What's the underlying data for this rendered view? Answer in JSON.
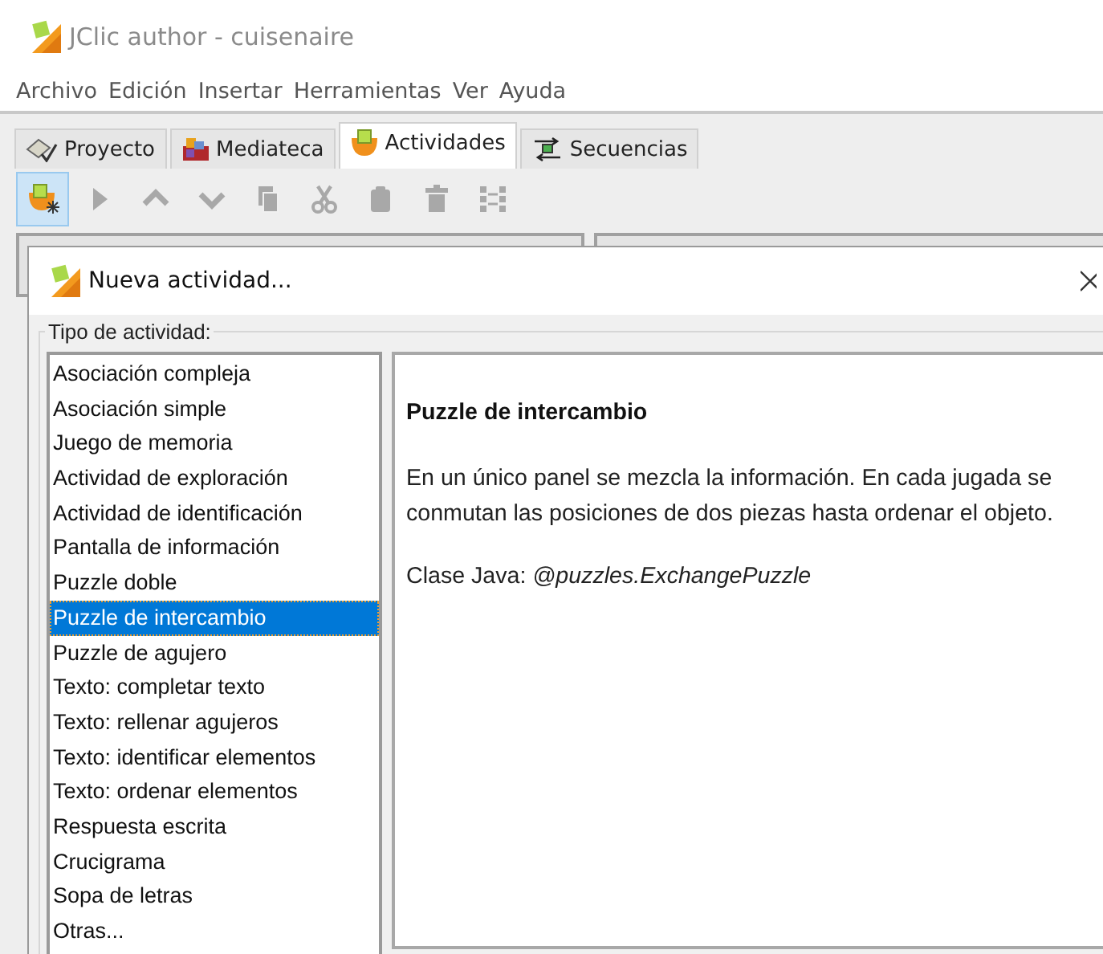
{
  "window": {
    "title": "JClic author - cuisenaire"
  },
  "menu": [
    "Archivo",
    "Edición",
    "Insertar",
    "Herramientas",
    "Ver",
    "Ayuda"
  ],
  "tabs": [
    {
      "label": "Proyecto",
      "selected": false
    },
    {
      "label": "Mediateca",
      "selected": false
    },
    {
      "label": "Actividades",
      "selected": true
    },
    {
      "label": "Secuencias",
      "selected": false
    }
  ],
  "toolbar": [
    {
      "selected": true,
      "disabled": false
    },
    {
      "selected": false,
      "disabled": true
    },
    {
      "selected": false,
      "disabled": true
    },
    {
      "selected": false,
      "disabled": true
    },
    {
      "selected": false,
      "disabled": true
    },
    {
      "selected": false,
      "disabled": true
    },
    {
      "selected": false,
      "disabled": true
    },
    {
      "selected": false,
      "disabled": true
    },
    {
      "selected": false,
      "disabled": true
    }
  ],
  "dialog": {
    "title": "Nueva actividad...",
    "group_label": "Tipo de actividad:",
    "activity_types": [
      {
        "label": "Asociación compleja",
        "selected": false
      },
      {
        "label": "Asociación simple",
        "selected": false
      },
      {
        "label": "Juego de memoria",
        "selected": false
      },
      {
        "label": "Actividad de exploración",
        "selected": false
      },
      {
        "label": "Actividad de identificación",
        "selected": false
      },
      {
        "label": "Pantalla de información",
        "selected": false
      },
      {
        "label": "Puzzle doble",
        "selected": false
      },
      {
        "label": "Puzzle de intercambio",
        "selected": true
      },
      {
        "label": "Puzzle de agujero",
        "selected": false
      },
      {
        "label": "Texto: completar texto",
        "selected": false
      },
      {
        "label": "Texto: rellenar agujeros",
        "selected": false
      },
      {
        "label": "Texto: identificar elementos",
        "selected": false
      },
      {
        "label": "Texto: ordenar elementos",
        "selected": false
      },
      {
        "label": "Respuesta escrita",
        "selected": false
      },
      {
        "label": "Crucigrama",
        "selected": false
      },
      {
        "label": "Sopa de letras",
        "selected": false
      },
      {
        "label": "Otras...",
        "selected": false
      }
    ],
    "description": {
      "heading": "Puzzle de intercambio",
      "text": "En un único panel se mezcla la información. En cada jugada se conmutan las posiciones de dos piezas hasta ordenar el objeto.",
      "class_line": "Clase Java: *@puzzles.ExchangePuzzle*"
    }
  }
}
